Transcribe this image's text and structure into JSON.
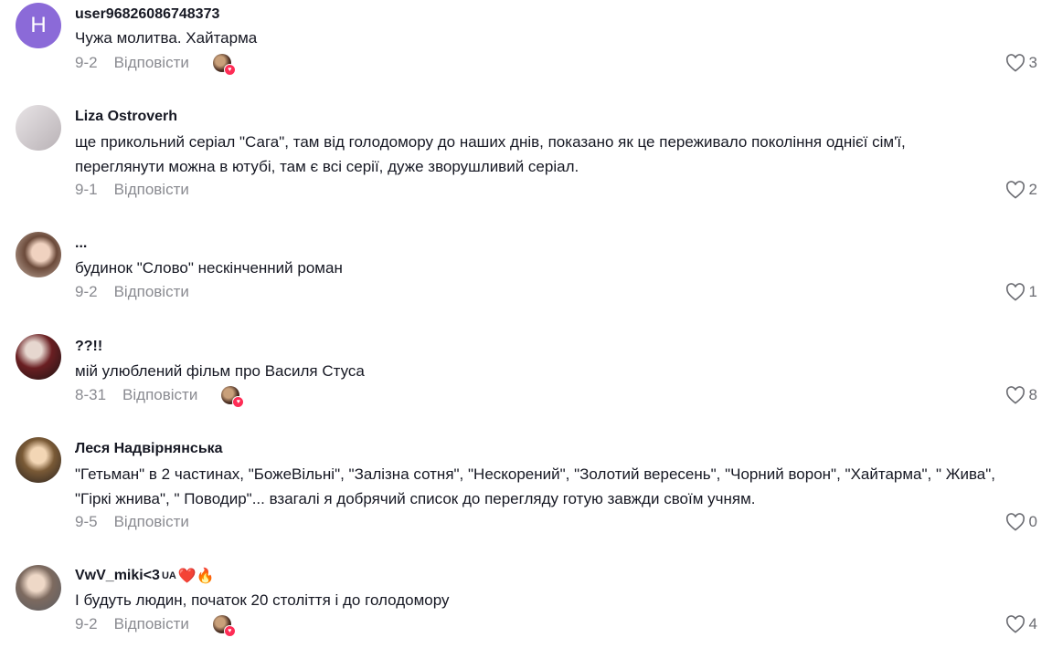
{
  "reply_label": "Відповісти",
  "comments": [
    {
      "username": "user96826086748373",
      "avatar_letter": "H",
      "text": "Чужа молитва. Хайтарма",
      "date": "9-2",
      "likes": "3",
      "creator_liked": true
    },
    {
      "username": "Liza Ostroverh",
      "text_lines": [
        "ще прикольний серіал \"Сага\", там від голодомору до наших днів, показано як це переживало покоління однієї сім'ї,",
        "переглянути можна в ютубі, там є всі серії, дуже зворушливий серіал."
      ],
      "date": "9-1",
      "likes": "2",
      "creator_liked": false
    },
    {
      "username": "...",
      "text": "будинок \"Слово\" нескінченний роман",
      "date": "9-2",
      "likes": "1",
      "creator_liked": false
    },
    {
      "username": "??!!",
      "text": "мій улюблений фільм про Василя Стуса",
      "date": "8-31",
      "likes": "8",
      "creator_liked": true
    },
    {
      "username": "Леся Надвірнянська",
      "text_lines": [
        "\"Гетьман\" в 2 частинах, \"БожеВільні\", \"Залізна сотня\", \"Нескорений\", \"Золотий вересень\", \"Чорний ворон\", \"Хайтарма\", \" Жива\",",
        "\"Гіркі жнива\", \" Поводир\"... взагалі я добрячий список до перегляду готую завжди своїм учням."
      ],
      "date": "9-5",
      "likes": "0",
      "creator_liked": false
    },
    {
      "username": "VwV_miki<3",
      "username_suffix": "UA",
      "username_emoji": "❤️🔥",
      "text": "І будуть людин, початок 20 століття і до голодомору",
      "date": "9-2",
      "likes": "4",
      "creator_liked": true
    }
  ],
  "colors": {
    "text": "#161823",
    "meta": "#8a8b91",
    "creator_heart": "#fe2c55",
    "avatar_letter_bg": "#8b6ad8"
  }
}
